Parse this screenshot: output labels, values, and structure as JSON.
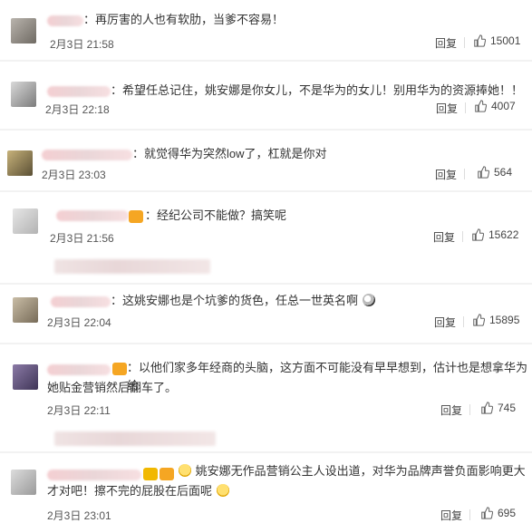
{
  "comments": [
    {
      "text": "：再厉害的人也有软肋，当爹不容易！",
      "time": "2月3日 21:58",
      "reply": "回复",
      "likes": "15001"
    },
    {
      "text": "：希望任总记住，姚安娜是你女儿，不是华为的女儿！别用华为的资源捧她！！",
      "time": "2月3日 22:18",
      "reply": "回复",
      "likes": "4007"
    },
    {
      "text": "：就觉得华为突然low了，杠就是你对",
      "time": "2月3日 23:03",
      "reply": "回复",
      "likes": "564"
    },
    {
      "text": "：经纪公司不能做？搞笑呢",
      "time": "2月3日 21:56",
      "reply": "回复",
      "likes": "15622"
    },
    {
      "text": "：这姚安娜也是个坑爹的货色，任总一世英名啊",
      "time": "2月3日 22:04",
      "reply": "回复",
      "likes": "15895"
    },
    {
      "text_line1": "：以他们家多年经商的头脑，这方面不可能没有早早想到，估计也是想拿华为给",
      "text_line2": "她贴金营销然后翻车了。",
      "time": "2月3日 22:11",
      "reply": "回复",
      "likes": "745"
    },
    {
      "text_line1": "姚安娜无作品营销公主人设出道，对华为品牌声誉负面影响更大",
      "text_line2": "才对吧！擦不完的屁股在后面呢",
      "time": "2月3日 23:01",
      "reply": "回复",
      "likes": "695"
    }
  ],
  "icons": {
    "like": "thumbs-up-icon",
    "cry": "crying-emoji-icon",
    "shock": "shocked-emoji-icon",
    "laugh": "laughing-emoji-icon"
  }
}
